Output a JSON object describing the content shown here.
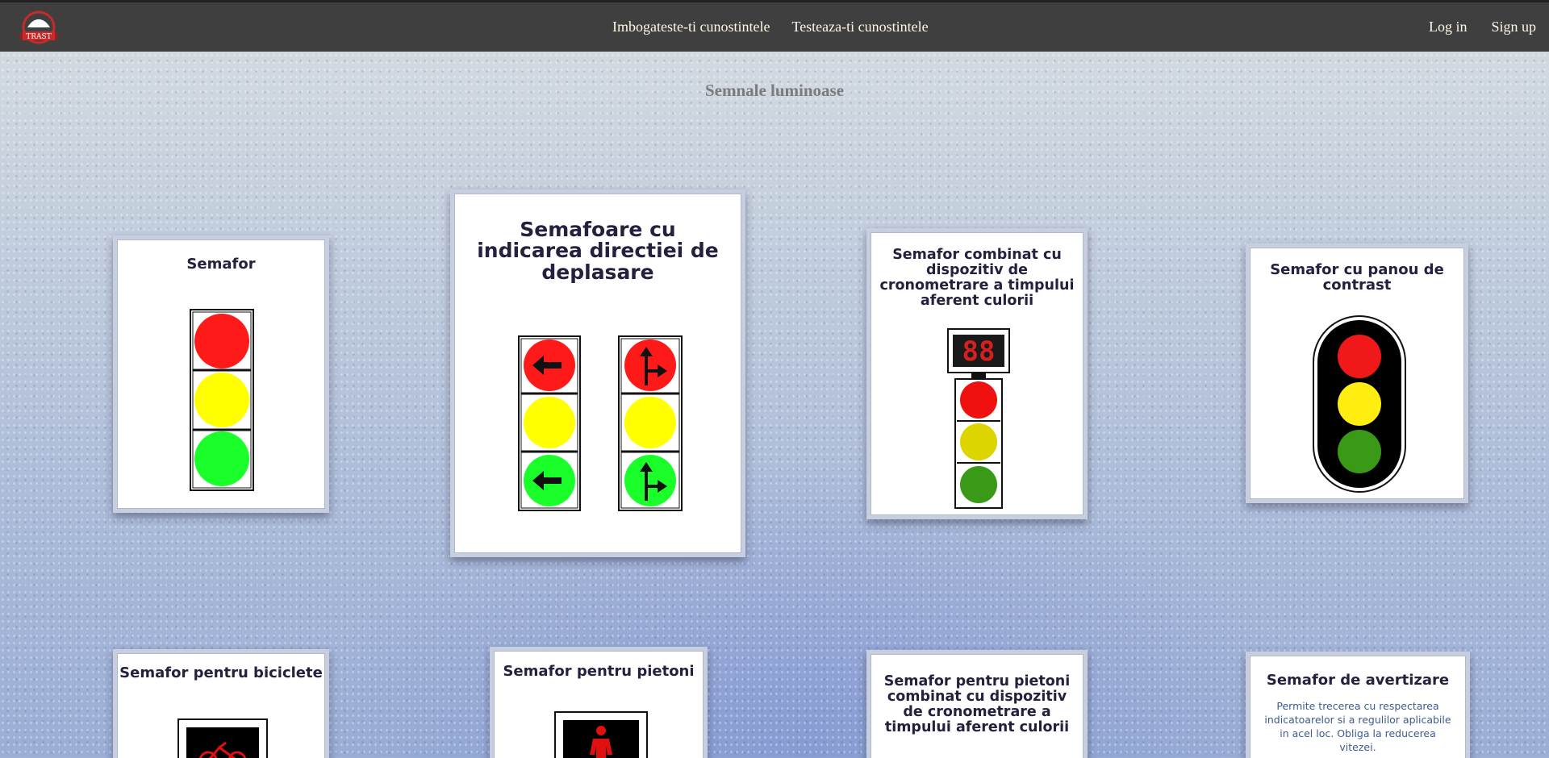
{
  "nav": {
    "logo_text": "TRAST",
    "links": [
      "Imbogateste-ti cunostintele",
      "Testeaza-ti cunostintele"
    ],
    "login": "Log in",
    "signup": "Sign up"
  },
  "page": {
    "title": "Semnale luminoase"
  },
  "cards": [
    {
      "title": "Semafor"
    },
    {
      "title": "Semafoare cu indicarea directiei de deplasare"
    },
    {
      "title": "Semafor combinat cu dispozitiv de cronometrare a timpului aferent culorii",
      "timer": "88"
    },
    {
      "title": "Semafor cu panou de contrast"
    },
    {
      "title": "Semafor pentru biciclete"
    },
    {
      "title": "Semafor pentru pietoni"
    },
    {
      "title": "Semafor pentru pietoni combinat cu dispozitiv de cronometrare a timpului aferent culorii"
    },
    {
      "title": "Semafor de avertizare",
      "description": "Permite trecerea cu respectarea indicatoarelor si a regulilor aplicabile in acel loc. Obliga la reducerea vitezei."
    }
  ],
  "colors": {
    "nav_bg": "#3f3f3f",
    "red": "#ff1a1a",
    "yellow": "#ffff00",
    "green": "#1aff2a"
  }
}
